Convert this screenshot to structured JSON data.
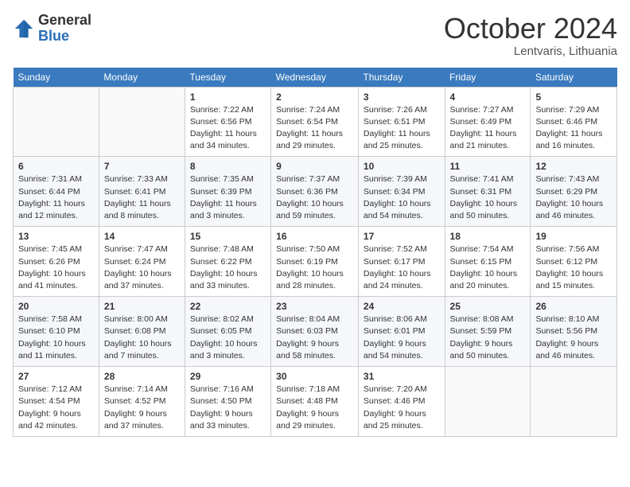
{
  "header": {
    "logo_general": "General",
    "logo_blue": "Blue",
    "month_title": "October 2024",
    "location": "Lentvaris, Lithuania"
  },
  "weekdays": [
    "Sunday",
    "Monday",
    "Tuesday",
    "Wednesday",
    "Thursday",
    "Friday",
    "Saturday"
  ],
  "weeks": [
    [
      {
        "day": "",
        "info": ""
      },
      {
        "day": "",
        "info": ""
      },
      {
        "day": "1",
        "info": "Sunrise: 7:22 AM\nSunset: 6:56 PM\nDaylight: 11 hours\nand 34 minutes."
      },
      {
        "day": "2",
        "info": "Sunrise: 7:24 AM\nSunset: 6:54 PM\nDaylight: 11 hours\nand 29 minutes."
      },
      {
        "day": "3",
        "info": "Sunrise: 7:26 AM\nSunset: 6:51 PM\nDaylight: 11 hours\nand 25 minutes."
      },
      {
        "day": "4",
        "info": "Sunrise: 7:27 AM\nSunset: 6:49 PM\nDaylight: 11 hours\nand 21 minutes."
      },
      {
        "day": "5",
        "info": "Sunrise: 7:29 AM\nSunset: 6:46 PM\nDaylight: 11 hours\nand 16 minutes."
      }
    ],
    [
      {
        "day": "6",
        "info": "Sunrise: 7:31 AM\nSunset: 6:44 PM\nDaylight: 11 hours\nand 12 minutes."
      },
      {
        "day": "7",
        "info": "Sunrise: 7:33 AM\nSunset: 6:41 PM\nDaylight: 11 hours\nand 8 minutes."
      },
      {
        "day": "8",
        "info": "Sunrise: 7:35 AM\nSunset: 6:39 PM\nDaylight: 11 hours\nand 3 minutes."
      },
      {
        "day": "9",
        "info": "Sunrise: 7:37 AM\nSunset: 6:36 PM\nDaylight: 10 hours\nand 59 minutes."
      },
      {
        "day": "10",
        "info": "Sunrise: 7:39 AM\nSunset: 6:34 PM\nDaylight: 10 hours\nand 54 minutes."
      },
      {
        "day": "11",
        "info": "Sunrise: 7:41 AM\nSunset: 6:31 PM\nDaylight: 10 hours\nand 50 minutes."
      },
      {
        "day": "12",
        "info": "Sunrise: 7:43 AM\nSunset: 6:29 PM\nDaylight: 10 hours\nand 46 minutes."
      }
    ],
    [
      {
        "day": "13",
        "info": "Sunrise: 7:45 AM\nSunset: 6:26 PM\nDaylight: 10 hours\nand 41 minutes."
      },
      {
        "day": "14",
        "info": "Sunrise: 7:47 AM\nSunset: 6:24 PM\nDaylight: 10 hours\nand 37 minutes."
      },
      {
        "day": "15",
        "info": "Sunrise: 7:48 AM\nSunset: 6:22 PM\nDaylight: 10 hours\nand 33 minutes."
      },
      {
        "day": "16",
        "info": "Sunrise: 7:50 AM\nSunset: 6:19 PM\nDaylight: 10 hours\nand 28 minutes."
      },
      {
        "day": "17",
        "info": "Sunrise: 7:52 AM\nSunset: 6:17 PM\nDaylight: 10 hours\nand 24 minutes."
      },
      {
        "day": "18",
        "info": "Sunrise: 7:54 AM\nSunset: 6:15 PM\nDaylight: 10 hours\nand 20 minutes."
      },
      {
        "day": "19",
        "info": "Sunrise: 7:56 AM\nSunset: 6:12 PM\nDaylight: 10 hours\nand 15 minutes."
      }
    ],
    [
      {
        "day": "20",
        "info": "Sunrise: 7:58 AM\nSunset: 6:10 PM\nDaylight: 10 hours\nand 11 minutes."
      },
      {
        "day": "21",
        "info": "Sunrise: 8:00 AM\nSunset: 6:08 PM\nDaylight: 10 hours\nand 7 minutes."
      },
      {
        "day": "22",
        "info": "Sunrise: 8:02 AM\nSunset: 6:05 PM\nDaylight: 10 hours\nand 3 minutes."
      },
      {
        "day": "23",
        "info": "Sunrise: 8:04 AM\nSunset: 6:03 PM\nDaylight: 9 hours\nand 58 minutes."
      },
      {
        "day": "24",
        "info": "Sunrise: 8:06 AM\nSunset: 6:01 PM\nDaylight: 9 hours\nand 54 minutes."
      },
      {
        "day": "25",
        "info": "Sunrise: 8:08 AM\nSunset: 5:59 PM\nDaylight: 9 hours\nand 50 minutes."
      },
      {
        "day": "26",
        "info": "Sunrise: 8:10 AM\nSunset: 5:56 PM\nDaylight: 9 hours\nand 46 minutes."
      }
    ],
    [
      {
        "day": "27",
        "info": "Sunrise: 7:12 AM\nSunset: 4:54 PM\nDaylight: 9 hours\nand 42 minutes."
      },
      {
        "day": "28",
        "info": "Sunrise: 7:14 AM\nSunset: 4:52 PM\nDaylight: 9 hours\nand 37 minutes."
      },
      {
        "day": "29",
        "info": "Sunrise: 7:16 AM\nSunset: 4:50 PM\nDaylight: 9 hours\nand 33 minutes."
      },
      {
        "day": "30",
        "info": "Sunrise: 7:18 AM\nSunset: 4:48 PM\nDaylight: 9 hours\nand 29 minutes."
      },
      {
        "day": "31",
        "info": "Sunrise: 7:20 AM\nSunset: 4:46 PM\nDaylight: 9 hours\nand 25 minutes."
      },
      {
        "day": "",
        "info": ""
      },
      {
        "day": "",
        "info": ""
      }
    ]
  ]
}
